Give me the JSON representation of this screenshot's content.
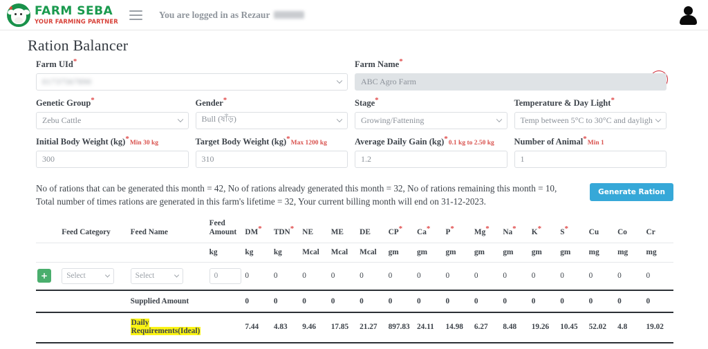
{
  "navbar": {
    "logo_title": "FARM SEBA",
    "logo_sub": "YOUR FARMING PARTNER",
    "menu_icon": "hamburger-icon",
    "login_text": "You are logged in as Rezaur",
    "avatar_icon": "user-avatar-icon"
  },
  "page": {
    "title": "Ration Balancer",
    "help_label": "?"
  },
  "form": {
    "farm_uid": {
      "label": "Farm UId",
      "value": "01737567890",
      "required": "*"
    },
    "farm_name": {
      "label": "Farm Name",
      "value": "ABC Agro Farm",
      "required": "*"
    },
    "genetic_group": {
      "label": "Genetic Group",
      "value": "Zebu Cattle",
      "required": "*"
    },
    "gender": {
      "label": "Gender",
      "value": "Bull (ষাঁড়)",
      "required": "*"
    },
    "stage": {
      "label": "Stage",
      "value": "Growing/Fattening",
      "required": "*"
    },
    "temperature": {
      "label": "Temperature & Day Light",
      "value": "Temp between 5°C to 30°C and dayligh",
      "required": "*"
    },
    "initial_weight": {
      "label": "Initial Body Weight (kg)",
      "hint": "Min 30 kg",
      "value": "300",
      "required": "*"
    },
    "target_weight": {
      "label": "Target Body Weight (kg)",
      "hint": "Max 1200 kg",
      "value": "310",
      "required": "*"
    },
    "average_daily_gain": {
      "label": "Average Daily Gain (kg)",
      "hint": "0.1 kg to 2.50 kg",
      "value": "1.2",
      "required": "*"
    },
    "number_of_animal": {
      "label": "Number of Animal",
      "hint": "Min 1",
      "value": "1",
      "required": "*"
    }
  },
  "info": {
    "text": "No of rations that can be generated this month = 42, No of rations already generated this month = 32, No of rations remaining this month = 10, Total number of times rations are generated in this farm's lifetime = 32, Your current billing month will end on 31-12-2023.",
    "generate_button": "Generate Ration"
  },
  "table": {
    "headers": [
      "Feed Category",
      "Feed Name",
      "Feed Amount",
      "DM",
      "TDN",
      "NE",
      "ME",
      "DE",
      "CP",
      "Ca",
      "P",
      "Mg",
      "Na",
      "K",
      "S",
      "Cu",
      "Co",
      "Cr"
    ],
    "header_required": [
      "",
      "",
      "",
      "*",
      "*",
      "",
      "",
      "",
      "*",
      "*",
      "*",
      "*",
      "*",
      "*",
      "*",
      "",
      "",
      ""
    ],
    "units": [
      "",
      "",
      "kg",
      "kg",
      "kg",
      "Mcal",
      "Mcal",
      "Mcal",
      "gm",
      "gm",
      "gm",
      "gm",
      "gm",
      "gm",
      "gm",
      "mg",
      "mg",
      "mg"
    ],
    "input_row": {
      "add_button": "+",
      "category_placeholder": "Select",
      "name_placeholder": "Select",
      "amount_value": "0",
      "values": [
        "0",
        "0",
        "0",
        "0",
        "0",
        "0",
        "0",
        "0",
        "0",
        "0",
        "0",
        "0",
        "0",
        "0",
        "0"
      ]
    },
    "supplied_row": {
      "label": "Supplied Amount",
      "values": [
        "0",
        "0",
        "0",
        "0",
        "0",
        "0",
        "0",
        "0",
        "0",
        "0",
        "0",
        "0",
        "0",
        "0",
        "0"
      ]
    },
    "daily_row": {
      "label_line1": "Daily",
      "label_line2": "Requirements(Ideal)",
      "values": [
        "7.44",
        "4.83",
        "9.46",
        "17.85",
        "21.27",
        "897.83",
        "24.11",
        "14.98",
        "6.27",
        "8.48",
        "19.26",
        "10.45",
        "52.02",
        "4.8",
        "19.02"
      ]
    }
  },
  "colors": {
    "brand_green": "#1a9a4e",
    "brand_red": "#d8433a",
    "accent_blue": "#36a8d8",
    "add_green": "#4aae6d",
    "help_red": "#cf2431",
    "highlight": "#fbf414"
  }
}
